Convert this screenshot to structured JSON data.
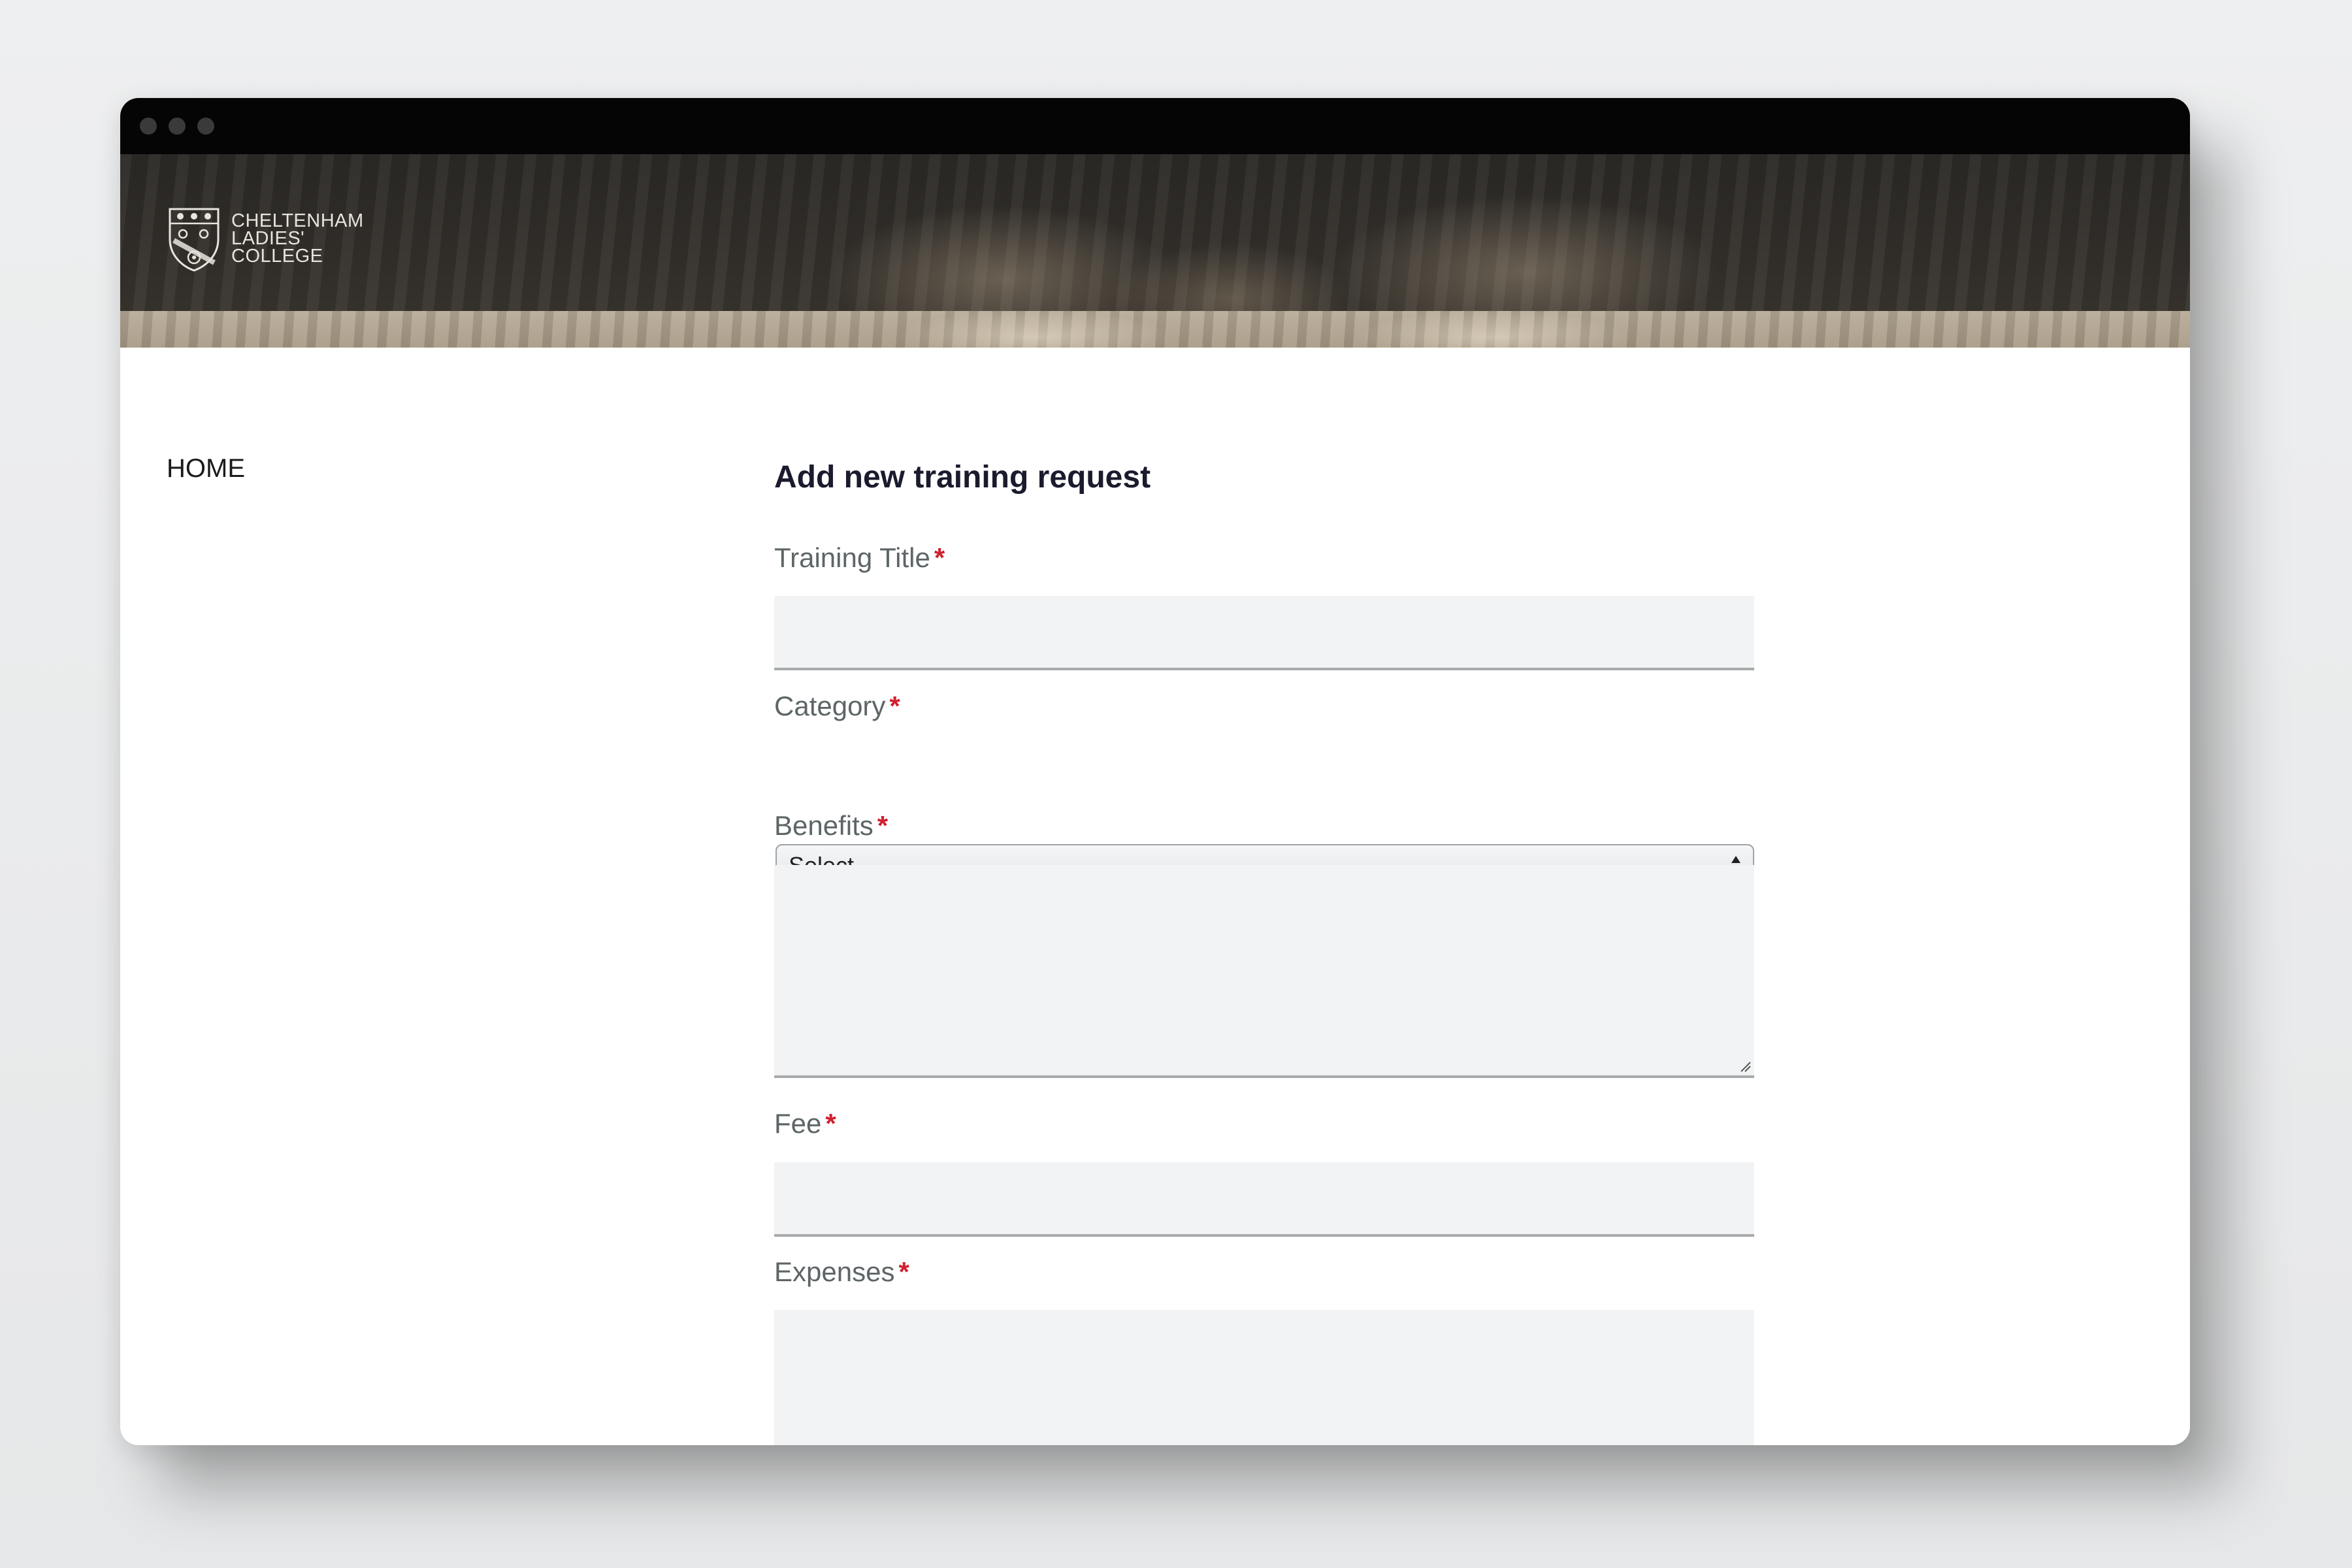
{
  "brand": {
    "name_line1": "CHELTENHAM",
    "name_line2": "LADIES'",
    "name_line3": "COLLEGE"
  },
  "nav": {
    "home_label": "HOME"
  },
  "form": {
    "title": "Add new training request",
    "required_marker": "*",
    "training_title": {
      "label": "Training Title",
      "value": ""
    },
    "category": {
      "label": "Category",
      "selected": "Select ..."
    },
    "benefits": {
      "label": "Benefits",
      "value": ""
    },
    "fee": {
      "label": "Fee",
      "value": ""
    },
    "expenses": {
      "label": "Expenses",
      "value": ""
    }
  },
  "colors": {
    "required": "#d0202f",
    "label": "#5d6567",
    "field_bg": "#f2f3f4",
    "titlebar": "#050505"
  }
}
